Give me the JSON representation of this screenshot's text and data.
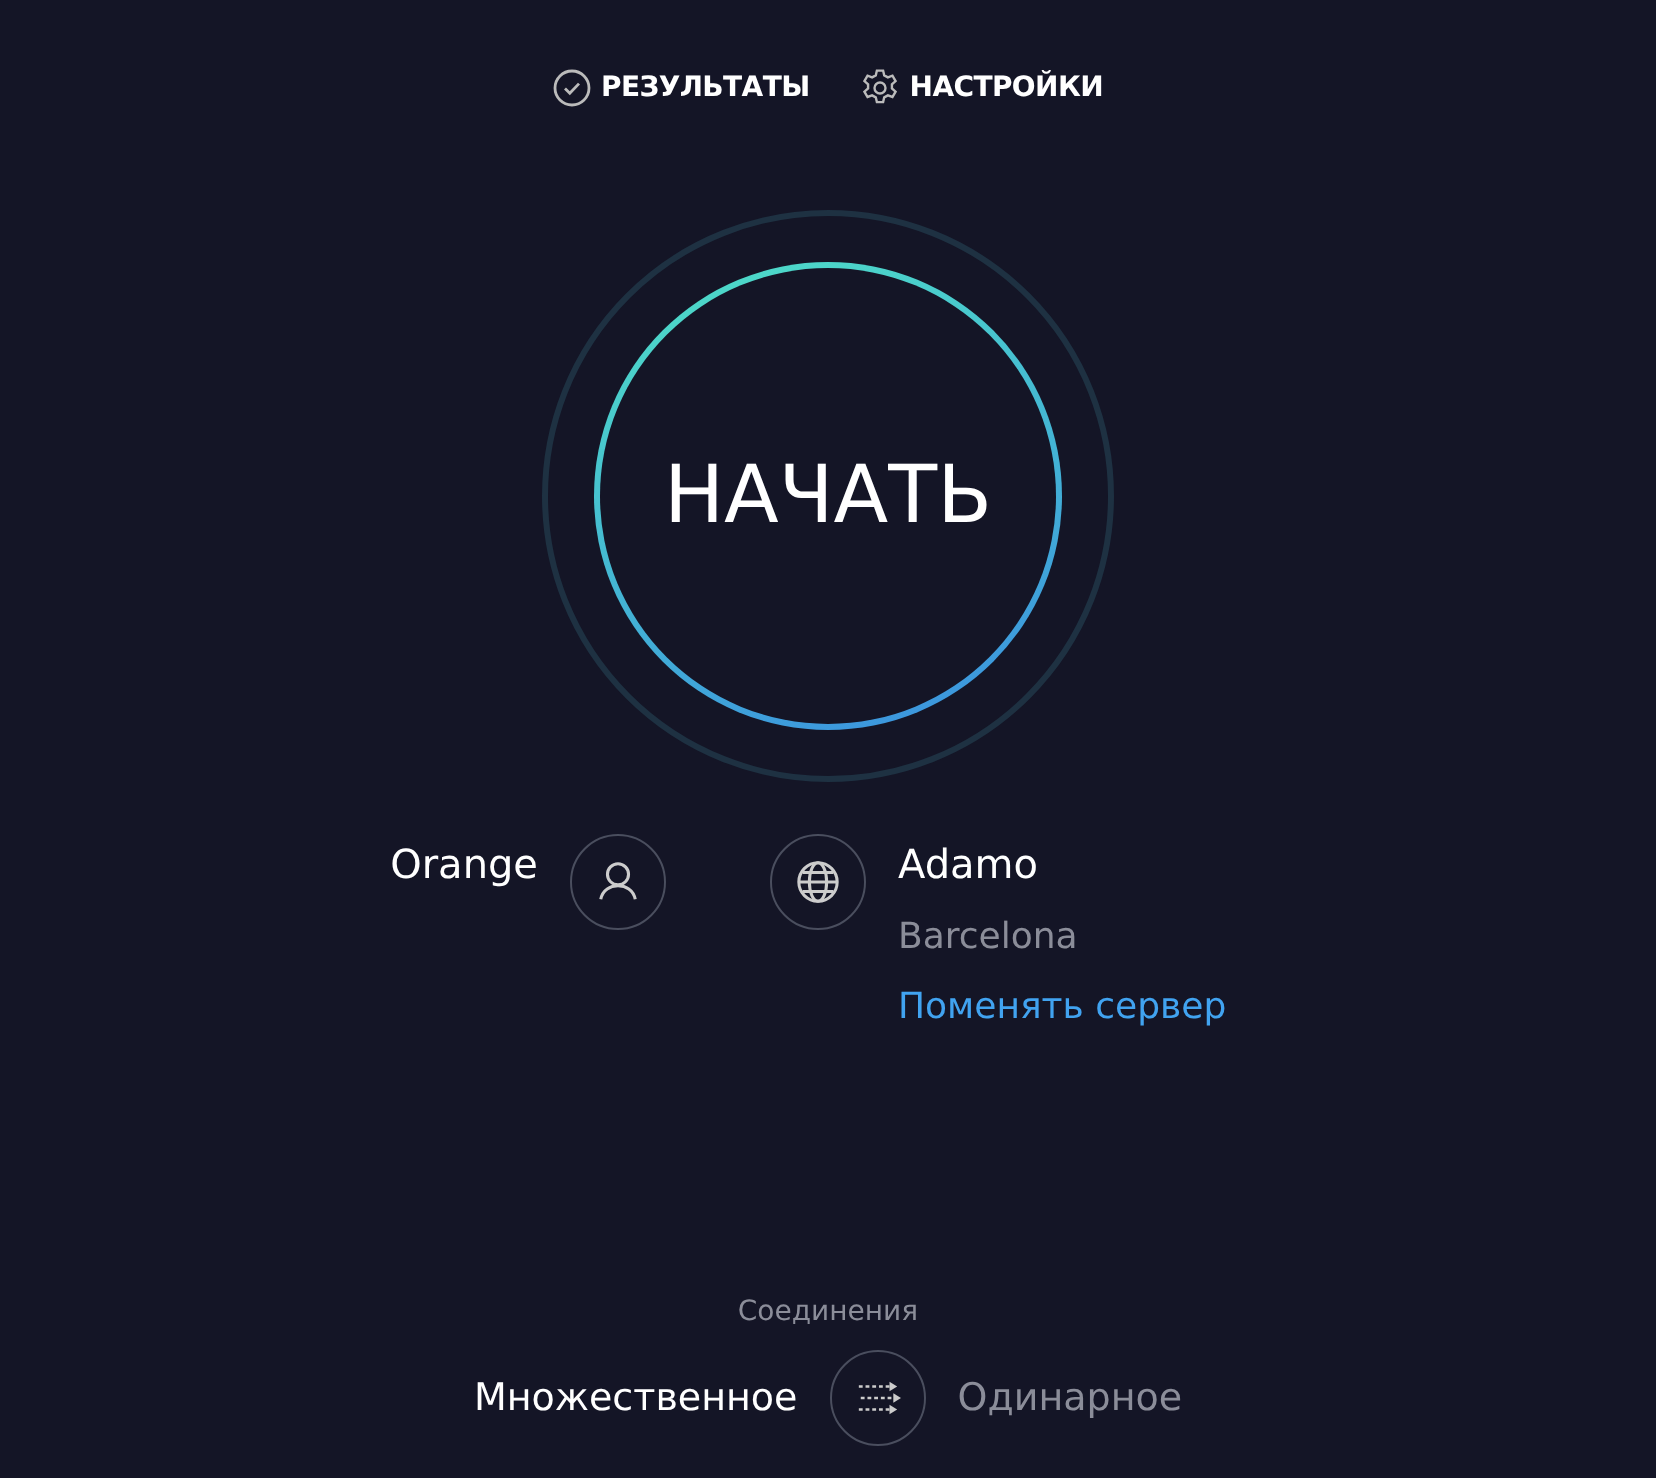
{
  "nav": [
    {
      "label": "РЕЗУЛЬТАТЫ",
      "kind": "results"
    },
    {
      "label": "НАСТРОЙКИ",
      "kind": "settings"
    }
  ],
  "start_button": "НАЧАТЬ",
  "provider": {
    "name": "Orange"
  },
  "server": {
    "name": "Adamo",
    "location": "Barcelona",
    "change_link": "Поменять сервер"
  },
  "connections": {
    "label": "Соединения",
    "options": [
      {
        "label": "Множественное",
        "selected": true
      },
      {
        "label": "Одинарное",
        "selected": false
      }
    ]
  }
}
